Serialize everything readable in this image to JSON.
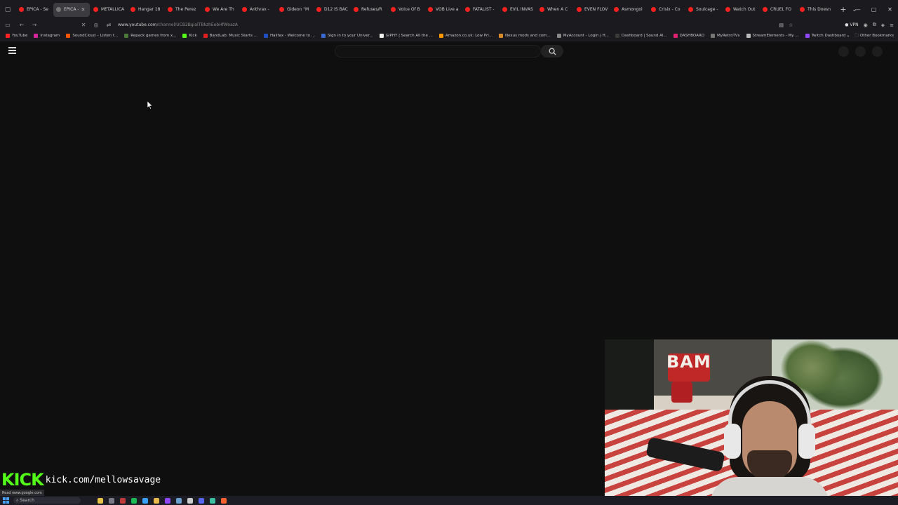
{
  "browser": {
    "tabs": [
      {
        "label": "EPICA - Se",
        "active": false
      },
      {
        "label": "EPICA -",
        "active": true
      },
      {
        "label": "METALLICA",
        "active": false
      },
      {
        "label": "Hangar 18",
        "active": false
      },
      {
        "label": "The Perez",
        "active": false
      },
      {
        "label": "We Are Th",
        "active": false
      },
      {
        "label": "Anthrax -",
        "active": false
      },
      {
        "label": "Gideon \"M",
        "active": false
      },
      {
        "label": "D12 IS BAC",
        "active": false
      },
      {
        "label": "Refuses/R",
        "active": false
      },
      {
        "label": "Voice Of B",
        "active": false
      },
      {
        "label": "VOB Live a",
        "active": false
      },
      {
        "label": "FATALIST -",
        "active": false
      },
      {
        "label": "EVIL INVAS",
        "active": false
      },
      {
        "label": "When A C",
        "active": false
      },
      {
        "label": "EVEN FLOV",
        "active": false
      },
      {
        "label": "Asmongol",
        "active": false
      },
      {
        "label": "Crisix - Co",
        "active": false
      },
      {
        "label": "Soulcage -",
        "active": false
      },
      {
        "label": "Watch Out",
        "active": false
      },
      {
        "label": "CRUEL FO",
        "active": false
      },
      {
        "label": "This Doesn",
        "active": false
      }
    ],
    "url_domain": "www.youtube.com",
    "url_path": "/channel/UCB2BgialTBkzhEebHfWoazA",
    "vpn_label": "VPN",
    "bookmarks": [
      {
        "label": "YouTube",
        "color": "#ff2020"
      },
      {
        "label": "Instagram",
        "color": "#d6249f"
      },
      {
        "label": "SoundCloud – Listen t...",
        "color": "#ff5500"
      },
      {
        "label": "Repack games from x...",
        "color": "#4a7a3a"
      },
      {
        "label": "Kick",
        "color": "#53fc18"
      },
      {
        "label": "BandLab: Music Starts ...",
        "color": "#e02020"
      },
      {
        "label": "Halifax - Welcome to ...",
        "color": "#2050c0"
      },
      {
        "label": "Sign in to your Univer...",
        "color": "#3a6ad0"
      },
      {
        "label": "GIPHY | Search All the ...",
        "color": "#eeeeee"
      },
      {
        "label": "Amazon.co.uk: Low Pri...",
        "color": "#ff9900"
      },
      {
        "label": "Nexus mods and com...",
        "color": "#d98a2a"
      },
      {
        "label": "MyAccount - Login | H...",
        "color": "#888888"
      },
      {
        "label": "Dashboard | Sound Al...",
        "color": "#3a3a3a"
      },
      {
        "label": "DASHBOARD",
        "color": "#e02070"
      },
      {
        "label": "MyRetroTVs",
        "color": "#777777"
      },
      {
        "label": "StreamElements - My ...",
        "color": "#bbbbbb"
      },
      {
        "label": "Twitch Dashboard",
        "color": "#9146ff"
      }
    ],
    "other_bookmarks": "Other Bookmarks",
    "status_text": "Read www.google.com"
  },
  "overlay": {
    "kick_logo": "KICK",
    "kick_url": "kick.com/mellowsavage"
  },
  "taskbar": {
    "search_label": "Search"
  },
  "colors": {
    "page_bg": "#0f0f0f",
    "kick_green": "#53fc18",
    "youtube_red": "#ff2020"
  }
}
